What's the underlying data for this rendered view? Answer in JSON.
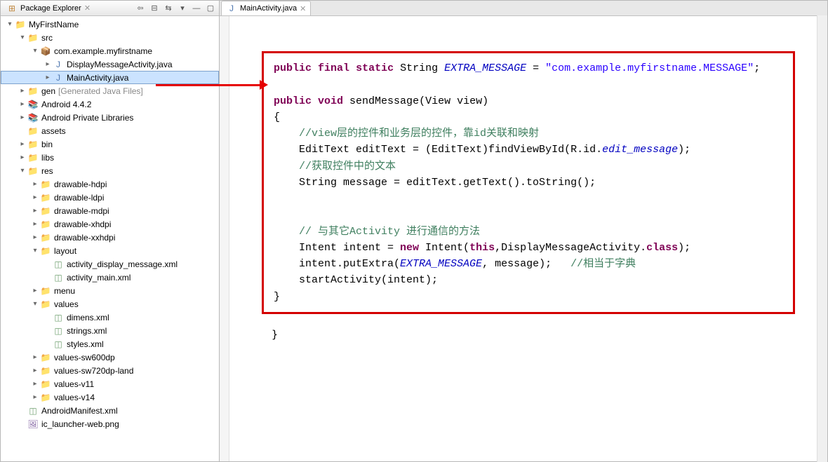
{
  "explorer": {
    "title": "Package Explorer",
    "toolbar": [
      "back-icon",
      "collapse-icon",
      "link-icon",
      "menu-icon",
      "min-icon",
      "max-icon"
    ],
    "tree": [
      {
        "d": 0,
        "tw": "▾",
        "ic": "proj",
        "label": "MyFirstName"
      },
      {
        "d": 1,
        "tw": "▾",
        "ic": "folder",
        "label": "src"
      },
      {
        "d": 2,
        "tw": "▾",
        "ic": "pkg",
        "label": "com.example.myfirstname"
      },
      {
        "d": 3,
        "tw": "▸",
        "ic": "java",
        "label": "DisplayMessageActivity.java"
      },
      {
        "d": 3,
        "tw": "▸",
        "ic": "java",
        "label": "MainActivity.java",
        "sel": true
      },
      {
        "d": 1,
        "tw": "▸",
        "ic": "folder",
        "label": "gen",
        "suffix": "[Generated Java Files]",
        "gray": true
      },
      {
        "d": 1,
        "tw": "▸",
        "ic": "lib",
        "label": "Android 4.4.2"
      },
      {
        "d": 1,
        "tw": "▸",
        "ic": "lib",
        "label": "Android Private Libraries"
      },
      {
        "d": 1,
        "tw": "",
        "ic": "folder",
        "label": "assets"
      },
      {
        "d": 1,
        "tw": "▸",
        "ic": "folder",
        "label": "bin"
      },
      {
        "d": 1,
        "tw": "▸",
        "ic": "folder",
        "label": "libs"
      },
      {
        "d": 1,
        "tw": "▾",
        "ic": "folder",
        "label": "res"
      },
      {
        "d": 2,
        "tw": "▸",
        "ic": "folder",
        "label": "drawable-hdpi"
      },
      {
        "d": 2,
        "tw": "▸",
        "ic": "folder",
        "label": "drawable-ldpi"
      },
      {
        "d": 2,
        "tw": "▸",
        "ic": "folder",
        "label": "drawable-mdpi"
      },
      {
        "d": 2,
        "tw": "▸",
        "ic": "folder",
        "label": "drawable-xhdpi"
      },
      {
        "d": 2,
        "tw": "▸",
        "ic": "folder",
        "label": "drawable-xxhdpi"
      },
      {
        "d": 2,
        "tw": "▾",
        "ic": "folder",
        "label": "layout"
      },
      {
        "d": 3,
        "tw": "",
        "ic": "xml",
        "label": "activity_display_message.xml"
      },
      {
        "d": 3,
        "tw": "",
        "ic": "xml",
        "label": "activity_main.xml"
      },
      {
        "d": 2,
        "tw": "▸",
        "ic": "folder",
        "label": "menu"
      },
      {
        "d": 2,
        "tw": "▾",
        "ic": "folder",
        "label": "values"
      },
      {
        "d": 3,
        "tw": "",
        "ic": "xml",
        "label": "dimens.xml"
      },
      {
        "d": 3,
        "tw": "",
        "ic": "xml",
        "label": "strings.xml"
      },
      {
        "d": 3,
        "tw": "",
        "ic": "xml",
        "label": "styles.xml"
      },
      {
        "d": 2,
        "tw": "▸",
        "ic": "folder",
        "label": "values-sw600dp"
      },
      {
        "d": 2,
        "tw": "▸",
        "ic": "folder",
        "label": "values-sw720dp-land"
      },
      {
        "d": 2,
        "tw": "▸",
        "ic": "folder",
        "label": "values-v11"
      },
      {
        "d": 2,
        "tw": "▸",
        "ic": "folder",
        "label": "values-v14"
      },
      {
        "d": 1,
        "tw": "",
        "ic": "xml",
        "label": "AndroidManifest.xml"
      },
      {
        "d": 1,
        "tw": "",
        "ic": "img",
        "label": "ic_launcher-web.png"
      }
    ]
  },
  "editor": {
    "tab_label": "MainActivity.java",
    "code_html": "<span class=\"kw\">public</span> <span class=\"kw\">final</span> <span class=\"kw\">static</span> String <span class=\"it\">EXTRA_MESSAGE</span> = <span class=\"str\">\"com.example.myfirstname.MESSAGE\"</span>;\n\n<span class=\"kw\">public</span> <span class=\"kw\">void</span> sendMessage(View view)\n{\n    <span class=\"cm\">//view层的控件和业务层的控件，靠id关联和映射</span>\n    EditText editText = (EditText)findViewById(R.id.<span class=\"it\">edit_message</span>);\n    <span class=\"cm\">//获取控件中的文本</span>\n    String message = editText.getText().toString();\n\n\n    <span class=\"cm\">// 与其它Activity 进行通信的方法</span>\n    Intent intent = <span class=\"kw\">new</span> Intent(<span class=\"kw\">this</span>,DisplayMessageActivity.<span class=\"kw\">class</span>);\n    intent.putExtra(<span class=\"it\">EXTRA_MESSAGE</span>, message);   <span class=\"cm\">//相当于字典</span>\n    startActivity(intent);\n}",
    "close_brace": "}"
  },
  "icons": {
    "proj": "📁",
    "folder": "📁",
    "pkg": "📦",
    "java": "J",
    "lib": "📚",
    "xml": "◫",
    "img": "🖼"
  }
}
